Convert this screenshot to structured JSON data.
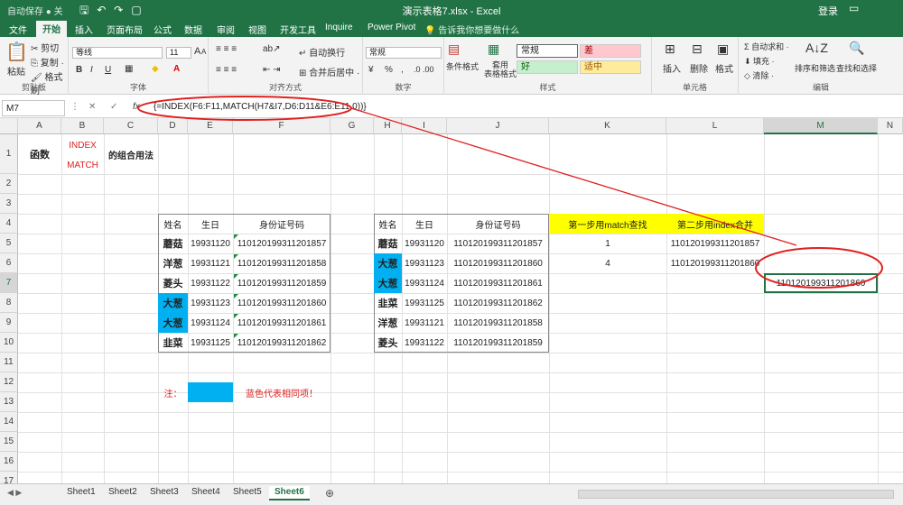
{
  "title": {
    "autosave": "自动保存 ● 关",
    "file": "演示表格7.xlsx - Excel",
    "login": "登录"
  },
  "tabs": [
    "文件",
    "开始",
    "插入",
    "页面布局",
    "公式",
    "数据",
    "审阅",
    "视图",
    "开发工具",
    "Inquire",
    "Power Pivot"
  ],
  "tell": "告诉我你想要做什么",
  "ribbon": {
    "clipboard": {
      "paste": "粘贴",
      "cut": "剪切",
      "copy": "复制 ·",
      "painter": "格式刷",
      "label": "剪贴板"
    },
    "font": {
      "name": "等线",
      "size": "11",
      "label": "字体",
      "bold": "B",
      "italic": "I",
      "underline": "U",
      "grow": "A",
      "shrink": "A",
      "fill": "◆",
      "color": "A"
    },
    "align": {
      "wrap": "自动换行",
      "merge": "合并后居中 ·",
      "label": "对齐方式"
    },
    "number": {
      "format": "常规",
      "label": "数字",
      "pct": "%",
      "comma": ",",
      "currency": "¥"
    },
    "styles": {
      "cond": "条件格式",
      "table": "套用\n表格格式",
      "normal": "常规",
      "bad": "差",
      "good": "好",
      "neutral": "适中",
      "label": "样式"
    },
    "cells": {
      "insert": "插入",
      "delete": "删除",
      "format": "格式",
      "label": "单元格"
    },
    "editing": {
      "autosum": "Σ 自动求和 ·",
      "fill": "填充 ·",
      "clear": "清除 ·",
      "sort": "排序和筛选",
      "find": "查找和选择",
      "label": "编辑"
    }
  },
  "formula_bar": {
    "name_box": "M7",
    "formula": "{=INDEX(F6:F11,MATCH(H7&I7,D6:D11&E6:E11,0))}"
  },
  "columns": [
    "A",
    "B",
    "C",
    "D",
    "E",
    "F",
    "G",
    "H",
    "I",
    "J",
    "K",
    "L",
    "M",
    "N"
  ],
  "rows": [
    "1",
    "2",
    "3",
    "4",
    "5",
    "6",
    "7",
    "8",
    "9",
    "10",
    "11",
    "12",
    "13",
    "14",
    "15",
    "16",
    "17"
  ],
  "sheet": {
    "title_func": "函数",
    "title_index": "INDEX",
    "title_match": "MATCH",
    "title_combo": "的组合用法",
    "left_headers": [
      "姓名",
      "生日",
      "身份证号码"
    ],
    "left_rows": [
      [
        "蘑菇",
        "19931120",
        "110120199311201857"
      ],
      [
        "洋葱",
        "19931121",
        "110120199311201858"
      ],
      [
        "菱头",
        "19931122",
        "110120199311201859"
      ],
      [
        "大葱",
        "19931123",
        "110120199311201860"
      ],
      [
        "大葱",
        "19931124",
        "110120199311201861"
      ],
      [
        "韭菜",
        "19931125",
        "110120199311201862"
      ]
    ],
    "right_headers": [
      "姓名",
      "生日",
      "身份证号码"
    ],
    "right_rows": [
      [
        "蘑菇",
        "19931120",
        "110120199311201857"
      ],
      [
        "大葱",
        "19931123",
        "110120199311201860"
      ],
      [
        "大葱",
        "19931124",
        "110120199311201861"
      ],
      [
        "韭菜",
        "19931125",
        "110120199311201862"
      ],
      [
        "洋葱",
        "19931121",
        "110120199311201858"
      ],
      [
        "菱头",
        "19931122",
        "110120199311201859"
      ]
    ],
    "step1_header": "第一步用match查找",
    "step2_header": "第二步用index合并",
    "step1_values": [
      "1",
      "4"
    ],
    "step2_values": [
      "110120199311201857",
      "110120199311201860"
    ],
    "m7_value": "110120199311201860",
    "note_label": "注：",
    "note_text": "蓝色代表相同项！"
  },
  "sheets": [
    "Sheet1",
    "Sheet2",
    "Sheet3",
    "Sheet4",
    "Sheet5",
    "Sheet6"
  ],
  "active_sheet": "Sheet6",
  "colors": {
    "excel_green": "#217346",
    "highlight_blue": "#00b0f0",
    "highlight_yellow": "#ffff00",
    "annotation_red": "#e02020"
  }
}
